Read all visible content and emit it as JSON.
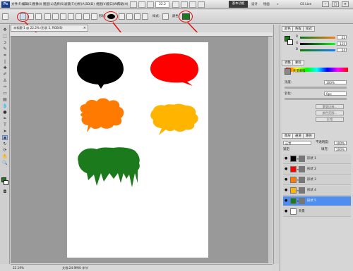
{
  "app": {
    "logo_text": "Ps",
    "menu": [
      "文件(F)",
      "编辑(E)",
      "图像(I)",
      "图层(L)",
      "选择(S)",
      "滤镜(T)",
      "分析(A)",
      "3D(D)",
      "视图(V)",
      "窗口(W)",
      "帮助(H)"
    ],
    "zoom": "22.2",
    "workspace": "基本功能",
    "workspace_links": [
      "设计",
      "绘画"
    ],
    "cs_live": "CS Live",
    "window_buttons": [
      "–",
      "□",
      "×"
    ]
  },
  "options": {
    "shape_label": "形状:",
    "style_label": "样式:",
    "color_label": "颜色:",
    "swatch_color": "#1b7a1b",
    "highlight_color": "#e01010"
  },
  "document": {
    "tab_title": "未标题-1 @ 22.2% (形状 5, RGB/8)",
    "status_zoom": "22.19%",
    "status_doc": "文档:24.9M/0 字节"
  },
  "shapes": [
    {
      "name": "black-speech-bubble",
      "color": "#000000"
    },
    {
      "name": "red-speech-bubble",
      "color": "#ff0000"
    },
    {
      "name": "orange-cloud-bubble",
      "color": "#ff7a00"
    },
    {
      "name": "yellow-cloud-bubble",
      "color": "#ffb400"
    },
    {
      "name": "green-drip-bubble",
      "color": "#1b7a1b"
    }
  ],
  "color_panel": {
    "tabs": [
      "颜色",
      "色板",
      "样式"
    ],
    "r_label": "R",
    "g_label": "G",
    "b_label": "B",
    "r_value": "22",
    "g_value": "125",
    "b_value": "24"
  },
  "adjust_panel": {
    "tabs": [
      "调整",
      "蒙版"
    ],
    "title": "矢量蒙版",
    "density_label": "浓度:",
    "density_value": "100%",
    "feather_label": "羽化:",
    "feather_value": "0px",
    "edge_button": "蒙版边缘...",
    "range_button": "颜色范围...",
    "invert_button": "反相"
  },
  "layers_panel": {
    "tabs": [
      "图层",
      "通道",
      "路径"
    ],
    "blend_mode": "正常",
    "opacity_label": "不透明度:",
    "opacity_value": "100%",
    "lock_label": "锁定:",
    "fill_label": "填充:",
    "fill_value": "100%",
    "layers": [
      {
        "name": "形状 1",
        "color": "#000000",
        "active": false
      },
      {
        "name": "形状 2",
        "color": "#ff0000",
        "active": false
      },
      {
        "name": "形状 3",
        "color": "#ff7a00",
        "active": false
      },
      {
        "name": "形状 4",
        "color": "#ffb400",
        "active": false
      },
      {
        "name": "形状 5",
        "color": "#1b7a1b",
        "active": true
      },
      {
        "name": "背景",
        "color": "#ffffff",
        "active": false
      }
    ]
  }
}
